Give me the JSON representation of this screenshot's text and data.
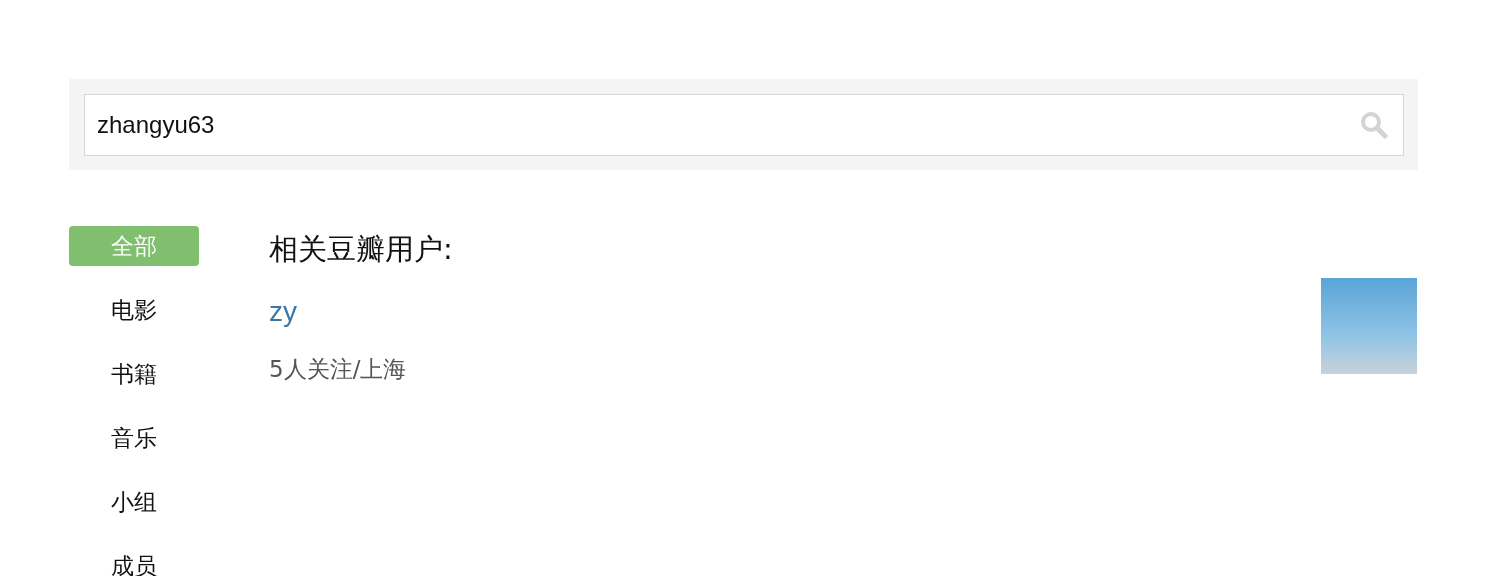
{
  "search": {
    "value": "zhangyu63"
  },
  "sidebar": {
    "items": [
      {
        "label": "全部",
        "selected": true
      },
      {
        "label": "电影",
        "selected": false
      },
      {
        "label": "书籍",
        "selected": false
      },
      {
        "label": "音乐",
        "selected": false
      },
      {
        "label": "小组",
        "selected": false
      },
      {
        "label": "成员",
        "selected": false
      }
    ]
  },
  "results": {
    "heading": "相关豆瓣用户:",
    "users": [
      {
        "name": "zy",
        "info": "5人关注/上海"
      }
    ]
  }
}
